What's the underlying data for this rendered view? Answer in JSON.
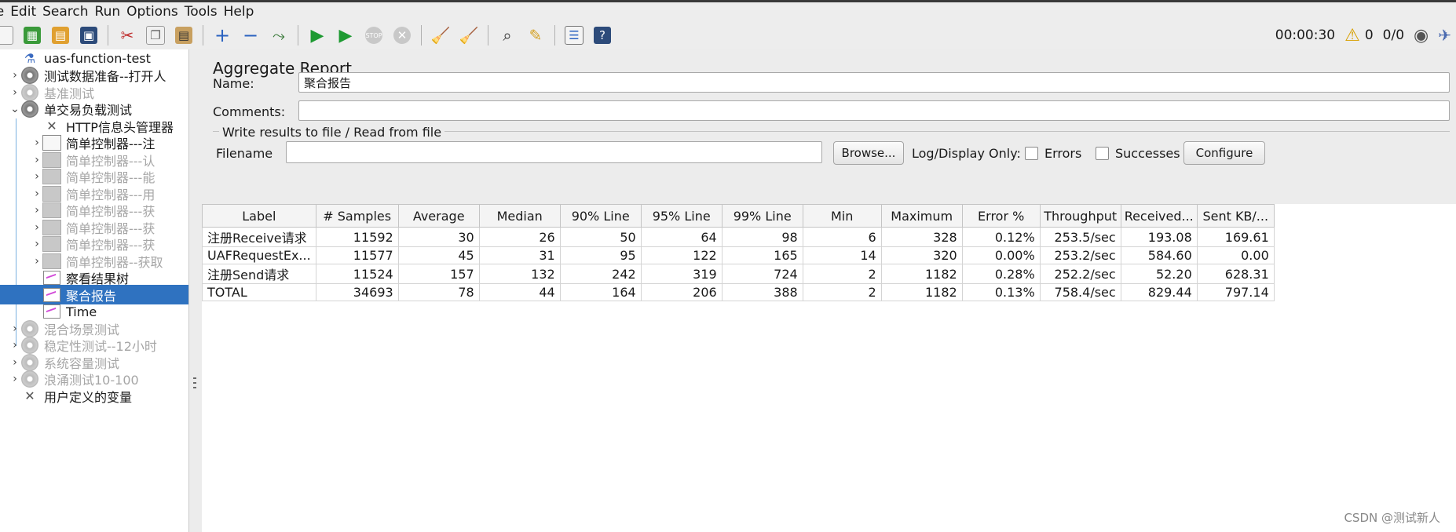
{
  "menu": [
    "le",
    "Edit",
    "Search",
    "Run",
    "Options",
    "Tools",
    "Help"
  ],
  "toolbar_status": {
    "elapsed": "00:00:30",
    "warnings": "0",
    "threads": "0/0"
  },
  "tree": [
    {
      "label": "uas-function-test",
      "level": 0,
      "icon": "flask-icon",
      "expander": "",
      "state": "normal"
    },
    {
      "label": "测试数据准备--打开人",
      "level": 0,
      "icon": "gear-icon",
      "expander": "›",
      "state": "normal"
    },
    {
      "label": "基准测试",
      "level": 0,
      "icon": "gear-icon",
      "expander": "›",
      "state": "disabled"
    },
    {
      "label": "单交易负载测试",
      "level": 0,
      "icon": "gear-icon",
      "expander": "⌄",
      "state": "normal"
    },
    {
      "label": "HTTP信息头管理器",
      "level": 1,
      "icon": "wrench-icon",
      "expander": "",
      "state": "normal"
    },
    {
      "label": "简单控制器---注",
      "level": 1,
      "icon": "controller-icon",
      "expander": "›",
      "state": "normal"
    },
    {
      "label": "简单控制器---认",
      "level": 1,
      "icon": "controller-icon",
      "expander": "›",
      "state": "disabled"
    },
    {
      "label": "简单控制器---能",
      "level": 1,
      "icon": "controller-icon",
      "expander": "›",
      "state": "disabled"
    },
    {
      "label": "简单控制器---用",
      "level": 1,
      "icon": "controller-icon",
      "expander": "›",
      "state": "disabled"
    },
    {
      "label": "简单控制器---获",
      "level": 1,
      "icon": "controller-icon",
      "expander": "›",
      "state": "disabled"
    },
    {
      "label": "简单控制器---获",
      "level": 1,
      "icon": "controller-icon",
      "expander": "›",
      "state": "disabled"
    },
    {
      "label": "简单控制器---获",
      "level": 1,
      "icon": "controller-icon",
      "expander": "›",
      "state": "disabled"
    },
    {
      "label": "简单控制器--获取",
      "level": 1,
      "icon": "controller-icon",
      "expander": "›",
      "state": "disabled"
    },
    {
      "label": "察看结果树",
      "level": 1,
      "icon": "chart-icon",
      "expander": "",
      "state": "normal"
    },
    {
      "label": "聚合报告",
      "level": 1,
      "icon": "chart-icon",
      "expander": "",
      "state": "selected"
    },
    {
      "label": "Time",
      "level": 1,
      "icon": "chart-icon",
      "expander": "",
      "state": "normal"
    },
    {
      "label": "混合场景测试",
      "level": 0,
      "icon": "gear-icon",
      "expander": "›",
      "state": "disabled"
    },
    {
      "label": "稳定性测试--12小时",
      "level": 0,
      "icon": "gear-icon",
      "expander": "›",
      "state": "disabled"
    },
    {
      "label": "系统容量测试",
      "level": 0,
      "icon": "gear-icon",
      "expander": "›",
      "state": "disabled"
    },
    {
      "label": "浪涌测试10-100",
      "level": 0,
      "icon": "gear-icon",
      "expander": "›",
      "state": "disabled"
    },
    {
      "label": "用户定义的变量",
      "level": 0,
      "icon": "wrench-icon",
      "expander": "",
      "state": "normal"
    }
  ],
  "panel": {
    "title": "Aggregate Report",
    "name_label": "Name:",
    "name_value": "聚合报告",
    "comments_label": "Comments:",
    "comments_value": "",
    "group_title": "Write results to file / Read from file",
    "filename_label": "Filename",
    "filename_value": "",
    "browse_label": "Browse...",
    "log_display_label": "Log/Display Only:",
    "errors_label": "Errors",
    "successes_label": "Successes",
    "configure_label": "Configure"
  },
  "table": {
    "columns": [
      "Label",
      "# Samples",
      "Average",
      "Median",
      "90% Line",
      "95% Line",
      "99% Line",
      "Min",
      "Maximum",
      "Error %",
      "Throughput",
      "Received...",
      "Sent KB/..."
    ],
    "rows": [
      [
        "注册Receive请求",
        "11592",
        "30",
        "26",
        "50",
        "64",
        "98",
        "6",
        "328",
        "0.12%",
        "253.5/sec",
        "193.08",
        "169.61"
      ],
      [
        "UAFRequestEx...",
        "11577",
        "45",
        "31",
        "95",
        "122",
        "165",
        "14",
        "320",
        "0.00%",
        "253.2/sec",
        "584.60",
        "0.00"
      ],
      [
        "注册Send请求",
        "11524",
        "157",
        "132",
        "242",
        "319",
        "724",
        "2",
        "1182",
        "0.28%",
        "252.2/sec",
        "52.20",
        "628.31"
      ],
      [
        "TOTAL",
        "34693",
        "78",
        "44",
        "164",
        "206",
        "388",
        "2",
        "1182",
        "0.13%",
        "758.4/sec",
        "829.44",
        "797.14"
      ]
    ]
  },
  "watermark": "CSDN @测试新人"
}
